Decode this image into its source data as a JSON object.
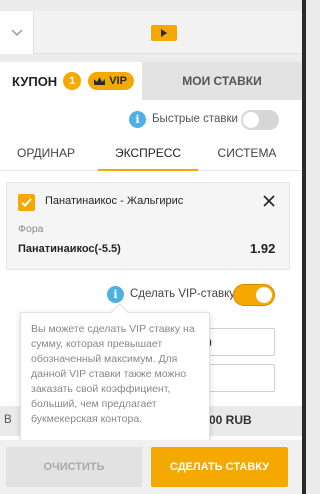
{
  "header": {
    "coupon_label": "КУПОН",
    "coupon_count": "1",
    "vip_label": "VIP",
    "my_bets_label": "МОИ СТАВКИ"
  },
  "quick_bets": {
    "label": "Быстрые ставки",
    "enabled": false
  },
  "bet_tabs": [
    {
      "label": "ОРДИНАР",
      "active": false
    },
    {
      "label": "ЭКСПРЕСС",
      "active": true
    },
    {
      "label": "СИСТЕМА",
      "active": false
    }
  ],
  "bet_card": {
    "event": "Панатинаикос - Жальгирис",
    "market": "Фора",
    "selection": "Панатинаикос(-5.5)",
    "odds": "1.92",
    "checked": true
  },
  "vip_bet": {
    "label": "Сделать VIP-ставку",
    "enabled": true,
    "tooltip": "Вы можете сделать VIP ставку на сумму, которая превышает обозначенный максимум. Для данной VIP ставки также можно заказать свой коэффициент, больший, чем предлагает букмекерская контора."
  },
  "hidden_fragments": {
    "field1_tail": "0",
    "amount_tail": "00 RUB",
    "band_left": "В"
  },
  "footer": {
    "clear_label": "ОЧИСТИТЬ",
    "make_bet_label": "СДЕЛАТЬ СТАВКУ"
  },
  "colors": {
    "accent": "#f5a800",
    "info": "#4fb0e6"
  }
}
